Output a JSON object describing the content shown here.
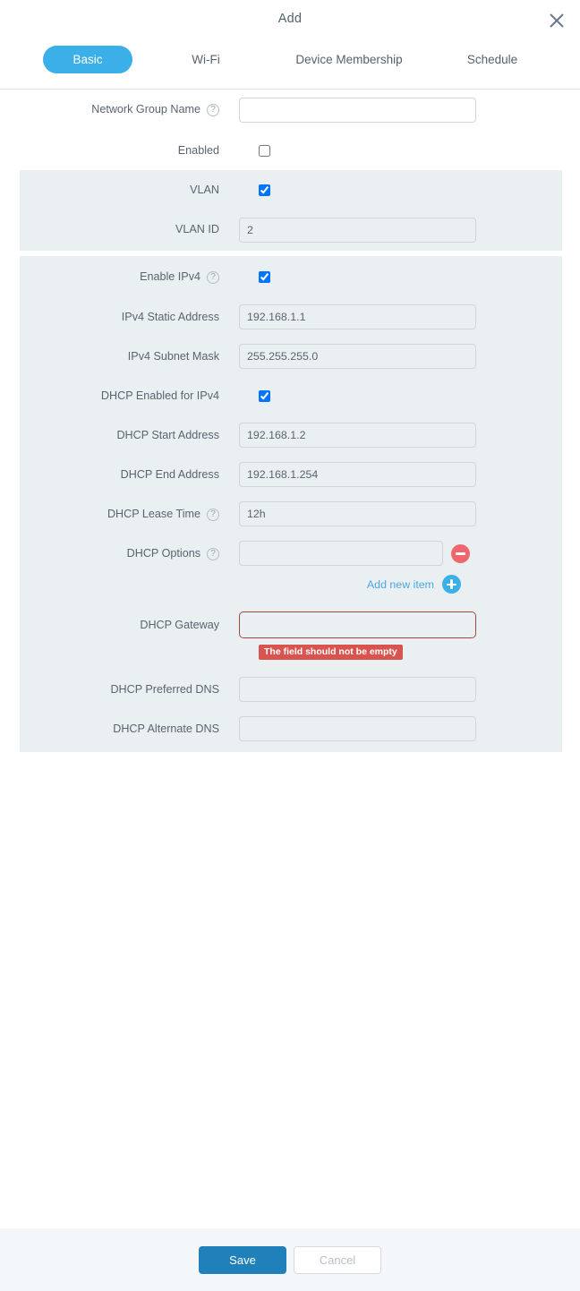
{
  "header": {
    "title": "Add",
    "close_icon": "close-icon"
  },
  "tabs": [
    {
      "label": "Basic",
      "active": true
    },
    {
      "label": "Wi-Fi",
      "active": false
    },
    {
      "label": "Device Membership",
      "active": false
    },
    {
      "label": "Schedule",
      "active": false
    }
  ],
  "form": {
    "network_group_name": {
      "label": "Network Group Name",
      "help": "?",
      "value": "",
      "placeholder": ""
    },
    "enabled": {
      "label": "Enabled",
      "checked": false
    },
    "vlan": {
      "label": "VLAN",
      "checked": true
    },
    "vlan_id": {
      "label": "VLAN ID",
      "value": "2"
    },
    "enable_ipv4": {
      "label": "Enable IPv4",
      "help": "?",
      "checked": true
    },
    "ipv4_static_address": {
      "label": "IPv4 Static Address",
      "value": "192.168.1.1"
    },
    "ipv4_subnet_mask": {
      "label": "IPv4 Subnet Mask",
      "value": "255.255.255.0"
    },
    "dhcp_enabled_for_ipv4": {
      "label": "DHCP Enabled for IPv4",
      "checked": true
    },
    "dhcp_start_address": {
      "label": "DHCP Start Address",
      "value": "192.168.1.2"
    },
    "dhcp_end_address": {
      "label": "DHCP End Address",
      "value": "192.168.1.254"
    },
    "dhcp_lease_time": {
      "label": "DHCP Lease Time",
      "help": "?",
      "value": "12h"
    },
    "dhcp_options": {
      "label": "DHCP Options",
      "help": "?",
      "value": "",
      "remove_icon": "minus-circle-icon"
    },
    "add_new_item": {
      "label": "Add new item",
      "add_icon": "plus-circle-icon"
    },
    "dhcp_gateway": {
      "label": "DHCP Gateway",
      "value": "",
      "error": "The field should not be empty"
    },
    "dhcp_preferred_dns": {
      "label": "DHCP Preferred DNS",
      "value": ""
    },
    "dhcp_alternate_dns": {
      "label": "DHCP Alternate DNS",
      "value": ""
    }
  },
  "footer": {
    "save_label": "Save",
    "cancel_label": "Cancel"
  },
  "colors": {
    "accent_blue": "#3bb0e8",
    "save_blue": "#2080b9",
    "error_red": "#d9534f",
    "error_border": "#a94442",
    "remove_red": "#f0666e",
    "section_bg": "#eaeff1",
    "footer_bg": "#f4f7fa"
  }
}
